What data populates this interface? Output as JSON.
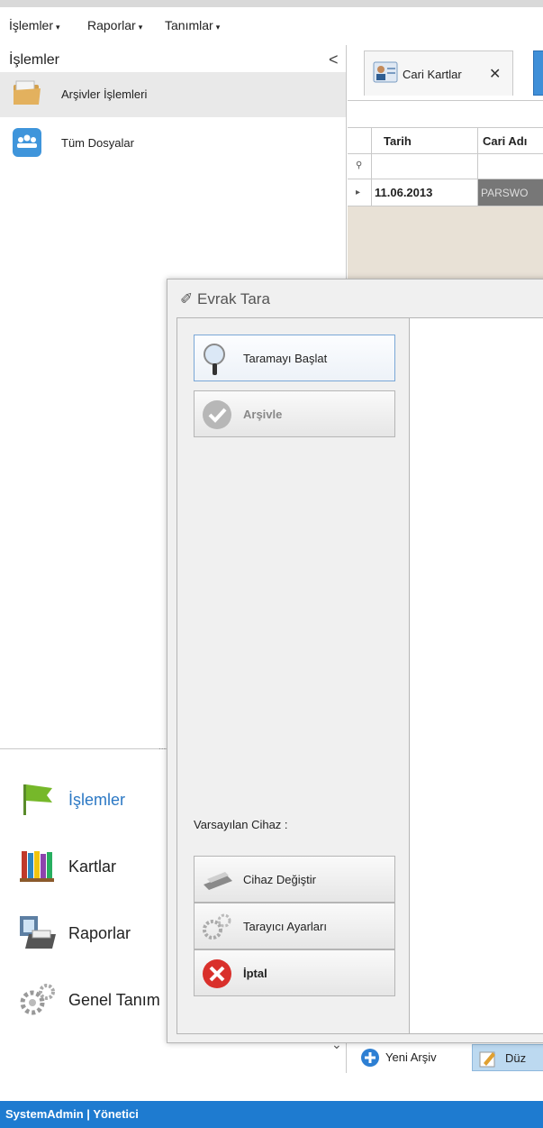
{
  "menu": {
    "items": [
      "İşlemler",
      "Raporlar",
      "Tanımlar"
    ]
  },
  "nav": {
    "header": "İşlemler",
    "collapse_glyph": "<",
    "items": [
      {
        "label": "Arşivler İşlemleri",
        "icon": "folder-icon",
        "selected": true
      },
      {
        "label": "Tüm Dosyalar",
        "icon": "users-icon",
        "selected": false
      }
    ],
    "bottom_items": [
      {
        "label": "İşlemler",
        "icon": "flag-icon",
        "active": true
      },
      {
        "label": "Kartlar",
        "icon": "books-icon",
        "active": false
      },
      {
        "label": "Raporlar",
        "icon": "printer-icon",
        "active": false
      },
      {
        "label": "Genel Tanım",
        "icon": "gears-icon",
        "active": false
      }
    ],
    "expand_glyph": "⌄"
  },
  "tabs": {
    "active_label": "Cari Kartlar",
    "close_glyph": "✕"
  },
  "grid": {
    "columns": [
      "Tarih",
      "Cari Adı"
    ],
    "rows": [
      {
        "date": "11.06.2013",
        "name": "PARSWO"
      }
    ]
  },
  "bottom_toolbar": {
    "new_label": "Yeni Arşiv",
    "edit_label": "Düz"
  },
  "status": {
    "text": "SystemAdmin | Yönetici"
  },
  "dialog": {
    "title": "Evrak Tara",
    "start_scan": "Taramayı Başlat",
    "archive": "Arşivle",
    "default_device": "Varsayılan Cihaz :",
    "change_device": "Cihaz Değiştir",
    "scanner_settings": "Tarayıcı Ayarları",
    "cancel": "İptal"
  },
  "colors": {
    "accent": "#1e7bd0",
    "active_nav": "#2b78c4",
    "grid_bg": "#e8e1d6",
    "cancel_red": "#d9302b"
  }
}
